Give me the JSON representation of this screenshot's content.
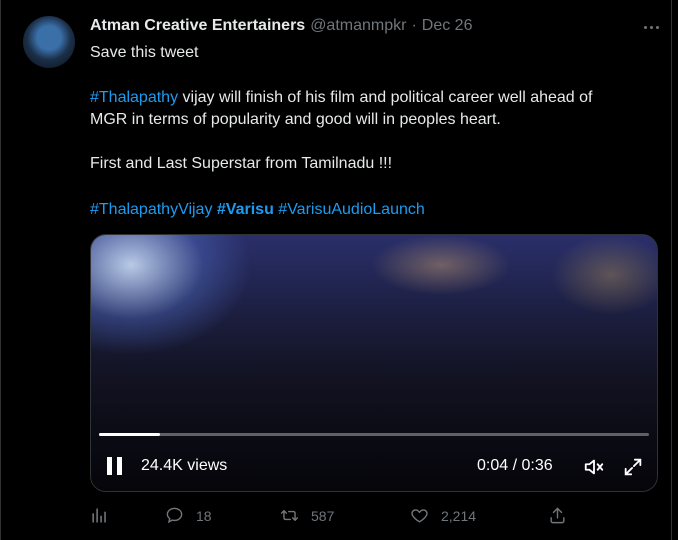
{
  "tweet": {
    "author_name": "Atman Creative Entertainers",
    "handle": "@atmanmpkr",
    "separator": "·",
    "date": "Dec 26",
    "line1": "Save this tweet",
    "line2_tag": "#Thalapathy",
    "line2_text": " vijay will finish of his film and political career well ahead of",
    "line3": "MGR in terms of popularity and good will in peoples heart.",
    "line4": "First and Last Superstar from Tamilnadu !!!",
    "hashtag1": "#ThalapathyVijay",
    "hashtag2": "#Varisu",
    "hashtag3": "#VarisuAudioLaunch"
  },
  "video": {
    "views": "24.4K views",
    "time": "0:04 / 0:36",
    "progress_fraction": 0.11
  },
  "actions": {
    "analytics_icon": "bar-chart-icon",
    "reply_count": "18",
    "retweet_count": "587",
    "like_count": "2,214",
    "share_icon": "share-icon"
  },
  "colors": {
    "accent": "#1d9bf0",
    "muted": "#71767b",
    "text": "#e7e9ea",
    "background": "#000000"
  }
}
